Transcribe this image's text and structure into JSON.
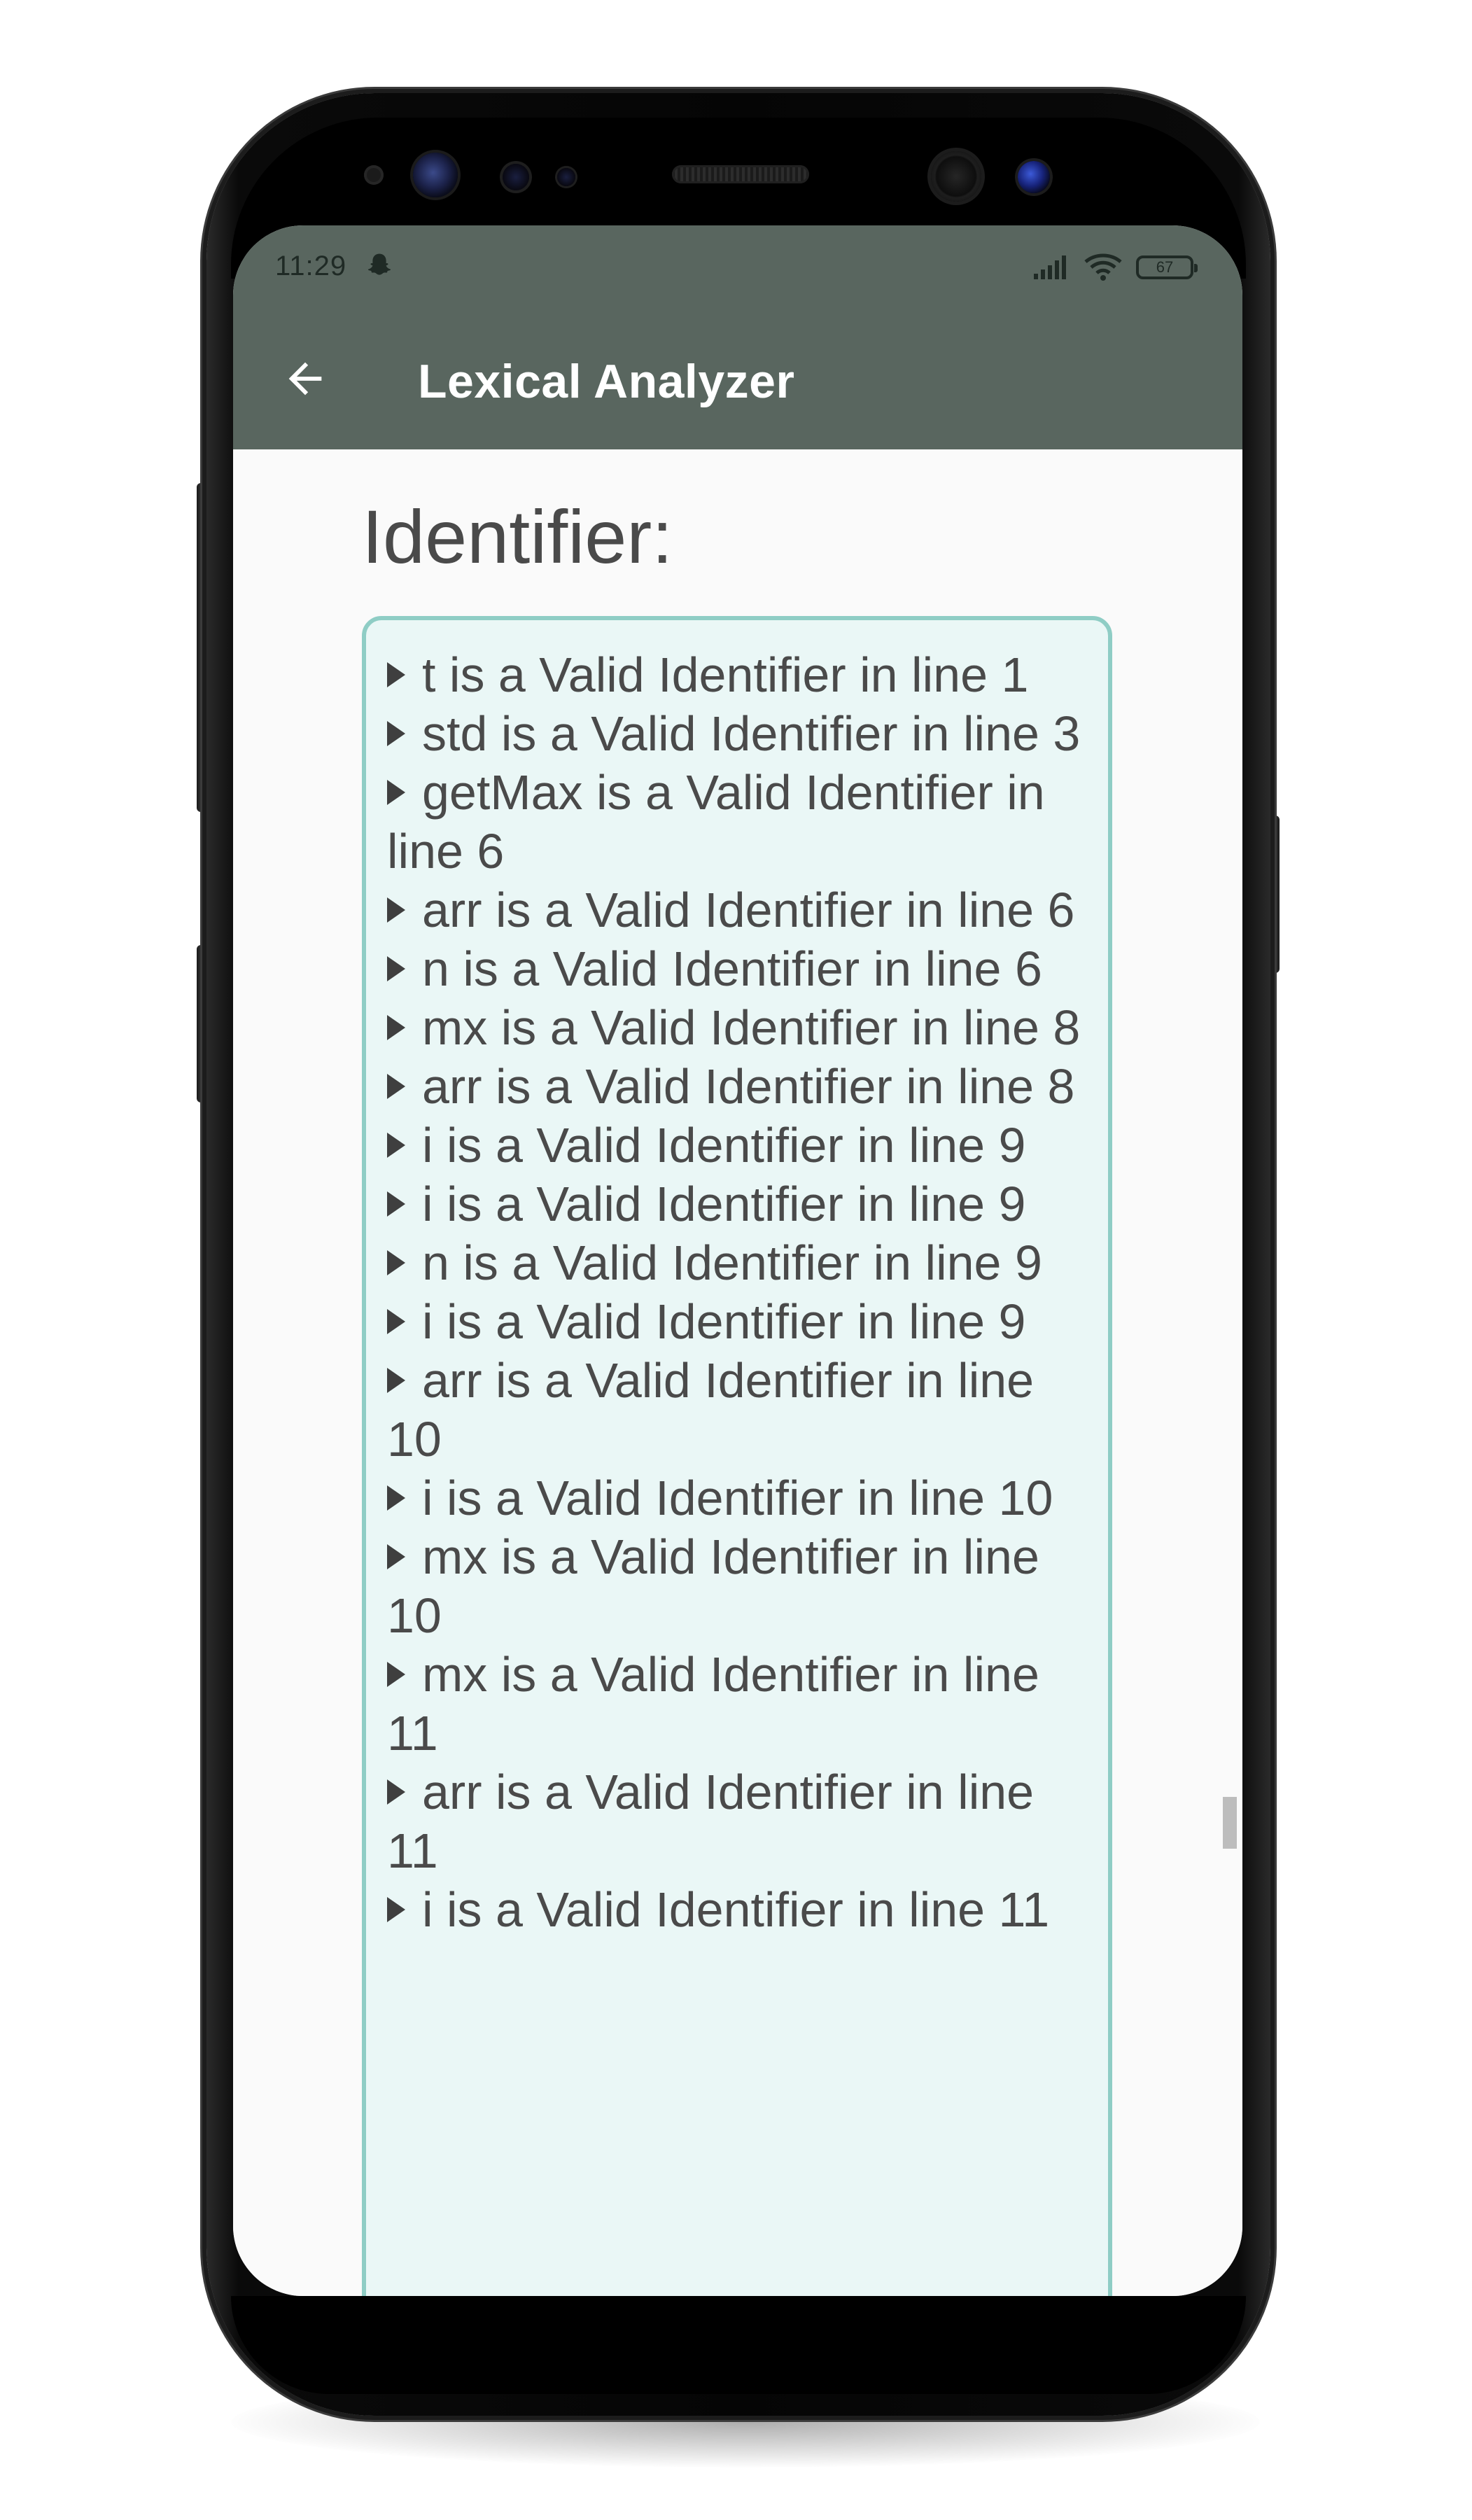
{
  "status_bar": {
    "time": "11:29",
    "battery": "67",
    "icons": [
      "ghost-icon",
      "signal-icon",
      "wifi-icon",
      "battery-icon"
    ]
  },
  "app_bar": {
    "title": "Lexical Analyzer",
    "back_icon": "arrow-left-icon"
  },
  "main": {
    "heading": "Identifier:",
    "items": [
      "t is a Valid Identifier in line 1",
      "std is a Valid Identifier in line 3",
      "getMax is a Valid Identifier in line 6",
      "arr is a Valid Identifier in line 6",
      "n is a Valid Identifier in line 6",
      "mx is a Valid Identifier in line 8",
      "arr is a Valid Identifier in line 8",
      "i is a Valid Identifier in line 9",
      "i is a Valid Identifier in line 9",
      "n is a Valid Identifier in line 9",
      "i is a Valid Identifier in line 9",
      "arr is a Valid Identifier in line 10",
      "i is a Valid Identifier in line 10",
      "mx is a Valid Identifier in line 10",
      "mx is a Valid Identifier in line 11",
      "arr is a Valid Identifier in line 11",
      "i is a Valid Identifier in line 11"
    ]
  },
  "colors": {
    "app_bar": "#59665f",
    "box_border": "#8fcdc5",
    "box_bg": "#eaf7f6",
    "text": "#4a4a4a"
  }
}
